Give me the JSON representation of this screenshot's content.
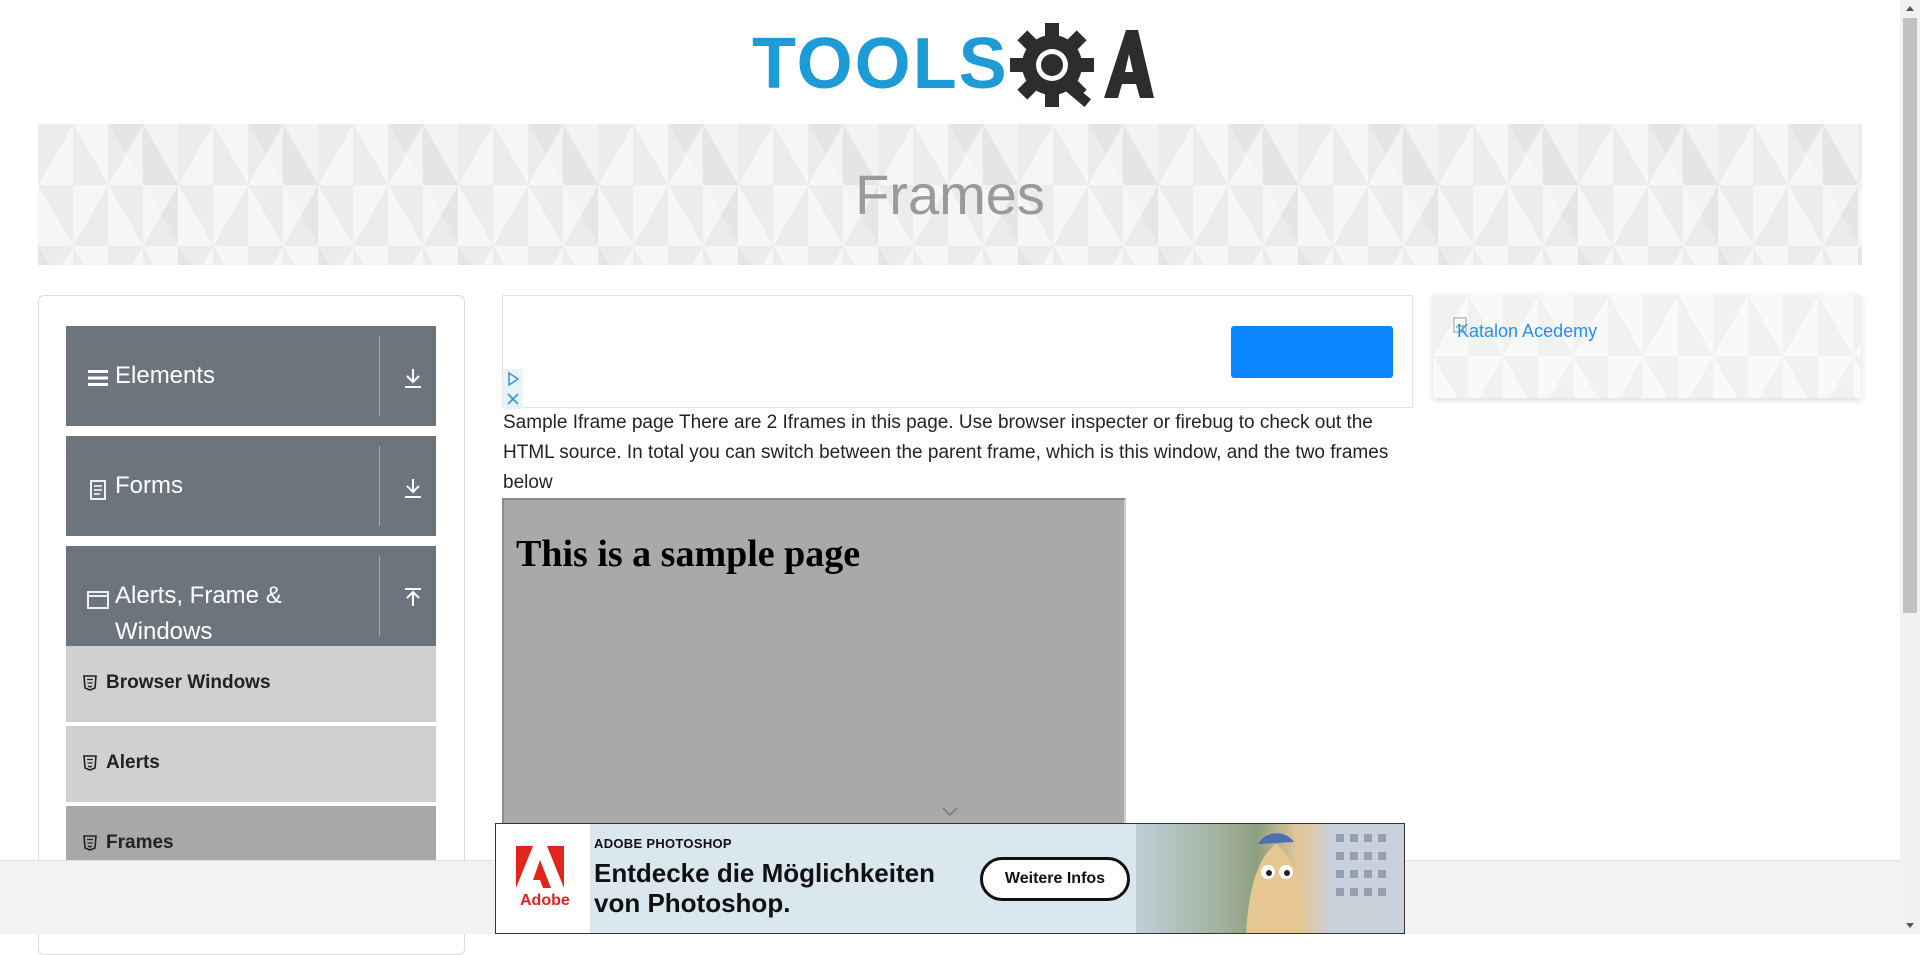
{
  "logo": {
    "tools_text": "TOOLS",
    "qa_text": "A",
    "brand_color": "#1e9ad6"
  },
  "banner": {
    "title": "Frames"
  },
  "sidebar": {
    "groups": [
      {
        "label": "Elements",
        "icon": "hamburger-icon",
        "arrow": "download-arrow-icon"
      },
      {
        "label": "Forms",
        "icon": "document-icon",
        "arrow": "download-arrow-icon"
      },
      {
        "label_line1": "Alerts, Frame &",
        "label_line2": "Windows",
        "icon": "window-icon",
        "arrow": "upload-arrow-icon"
      }
    ],
    "items": [
      {
        "label": "Browser Windows",
        "icon": "html5-icon"
      },
      {
        "label": "Alerts",
        "icon": "html5-icon"
      },
      {
        "label": "Frames",
        "icon": "html5-icon",
        "active": true
      }
    ]
  },
  "ad_top": {
    "button_color": "#0a84ff"
  },
  "description": "Sample Iframe page There are 2 Iframes in this page. Use browser inspecter or firebug to check out the HTML source. In total you can switch between the parent frame, which is this window, and the two frames below",
  "iframe": {
    "heading": "This is a sample page"
  },
  "right_ad": {
    "alt_text": "Katalon Acedemy"
  },
  "bottom_ad": {
    "brand": "ADOBE PHOTOSHOP",
    "headline": "Entdecke die Möglichkeiten von Photoshop.",
    "cta": "Weitere Infos",
    "logo_text": "Adobe",
    "logo_color": "#e1251b"
  }
}
